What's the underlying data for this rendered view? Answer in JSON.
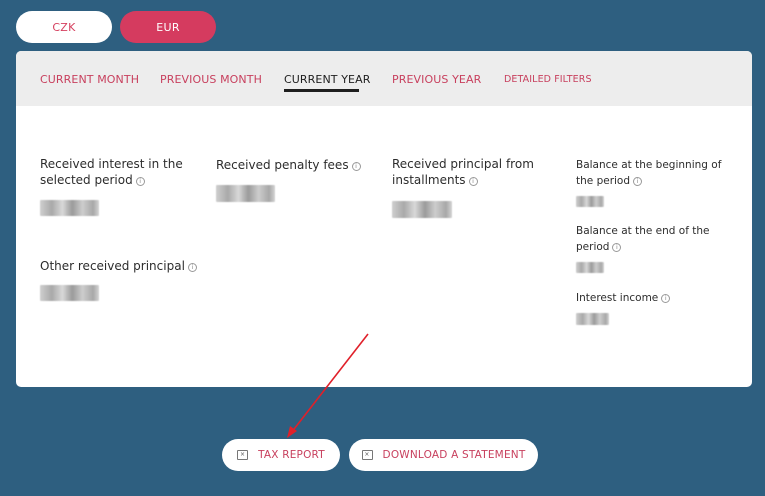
{
  "currency": {
    "options": [
      "CZK",
      "EUR"
    ],
    "selected": "EUR"
  },
  "tabs": [
    {
      "label": "CURRENT MONTH",
      "active": false
    },
    {
      "label": "PREVIOUS MONTH",
      "active": false
    },
    {
      "label": "CURRENT YEAR",
      "active": true
    },
    {
      "label": "PREVIOUS YEAR",
      "active": false
    },
    {
      "label": "DETAILED FILTERS",
      "active": false
    }
  ],
  "stats": {
    "received_interest": {
      "label_line1": "Received interest in the",
      "label_line2": "selected period"
    },
    "penalty_fees": {
      "label": "Received penalty fees"
    },
    "principal_installments": {
      "label_line1": "Received principal from",
      "label_line2": "installments"
    },
    "other_principal": {
      "label": "Other received principal"
    },
    "balance_begin": {
      "label_line1": "Balance at the beginning of",
      "label_line2": "the period"
    },
    "balance_end": {
      "label_line1": "Balance at the end of the",
      "label_line2": "period"
    },
    "interest_income": {
      "label": "Interest income"
    }
  },
  "info_icon_glyph": "i",
  "actions": {
    "tax_report": "TAX REPORT",
    "download_statement": "DOWNLOAD A STATEMENT"
  },
  "colors": {
    "background": "#2e5f80",
    "accent": "#d53b5f",
    "annotation_arrow": "#e0202a"
  },
  "icons": {
    "info": "info-icon",
    "spreadsheet": "spreadsheet-icon"
  }
}
